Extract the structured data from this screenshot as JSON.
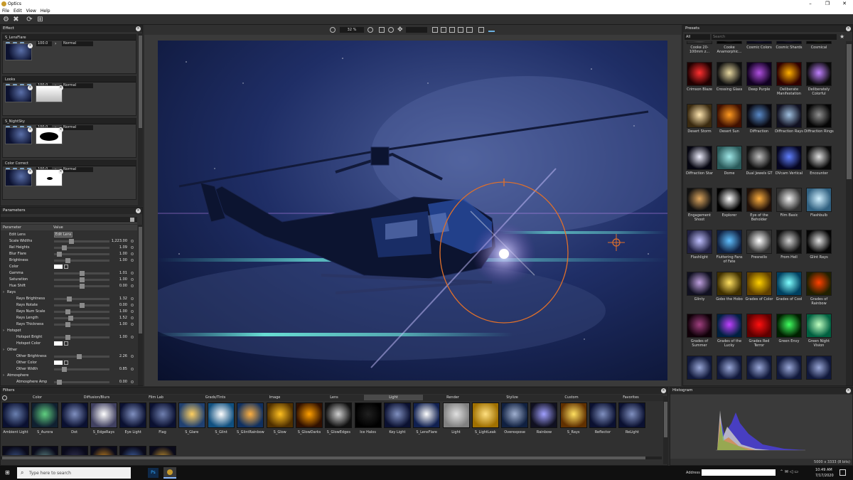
{
  "app": {
    "title": "Optics",
    "window_controls": [
      "–",
      "❐",
      "✕"
    ]
  },
  "menu": [
    "File",
    "Edit",
    "View",
    "Help"
  ],
  "toolbar": {
    "zoom": "32 %"
  },
  "effect": {
    "title": "Effect",
    "layers": [
      {
        "name": "S_LensFlare",
        "opacity": "100.0",
        "mode": "Normal",
        "mask": "none"
      },
      {
        "name": "Looks",
        "opacity": "100.0",
        "mode": "Normal",
        "mask": "gradient"
      },
      {
        "name": "S_NightSky",
        "opacity": "100.0",
        "mode": "Normal",
        "mask": "ellipse"
      },
      {
        "name": "Color Correct",
        "opacity": "100.0",
        "mode": "Normal",
        "mask": "dot"
      }
    ]
  },
  "parameters": {
    "title": "Parameters",
    "col_param": "Parameter",
    "col_value": "Value",
    "rows": [
      {
        "label": "Edit Lens",
        "indent": 1,
        "button": "Edit Lens"
      },
      {
        "label": "Scale Widths",
        "indent": 1,
        "slider": 0.3,
        "value": "1,223.00"
      },
      {
        "label": "Rel Heights",
        "indent": 1,
        "slider": 0.15,
        "value": "1.09"
      },
      {
        "label": "Blur Flare",
        "indent": 1,
        "slider": 0.05,
        "value": "1.00"
      },
      {
        "label": "Brightness",
        "indent": 1,
        "slider": 0.22,
        "value": "1.00"
      },
      {
        "label": "Color",
        "indent": 1,
        "color": "#ffffff"
      },
      {
        "label": "Gamma",
        "indent": 1,
        "slider": 0.5,
        "value": "1.01"
      },
      {
        "label": "Saturation",
        "indent": 1,
        "slider": 0.5,
        "value": "1.00"
      },
      {
        "label": "Hue Shift",
        "indent": 1,
        "slider": 0.5,
        "value": "0.00"
      },
      {
        "label": "Rays",
        "indent": 0,
        "group": true
      },
      {
        "label": "Rays Brightness",
        "indent": 2,
        "slider": 0.25,
        "value": "1.32"
      },
      {
        "label": "Rays Rotate",
        "indent": 2,
        "slider": 0.5,
        "value": "0.00"
      },
      {
        "label": "Rays Num Scale",
        "indent": 2,
        "slider": 0.22,
        "value": "1.00"
      },
      {
        "label": "Rays Length",
        "indent": 2,
        "slider": 0.28,
        "value": "1.52"
      },
      {
        "label": "Rays Thickness",
        "indent": 2,
        "slider": 0.22,
        "value": "1.00"
      },
      {
        "label": "Hotspot",
        "indent": 0,
        "group": true
      },
      {
        "label": "Hotspot Bright",
        "indent": 2,
        "slider": 0.22,
        "value": "1.00"
      },
      {
        "label": "Hotspot Color",
        "indent": 2,
        "color": "#ffffff"
      },
      {
        "label": "Other",
        "indent": 0,
        "group": true
      },
      {
        "label": "Other Brightness",
        "indent": 2,
        "slider": 0.45,
        "value": "2.26"
      },
      {
        "label": "Other Color",
        "indent": 2,
        "color": "#ffffff"
      },
      {
        "label": "Other Width",
        "indent": 2,
        "slider": 0.16,
        "value": "0.85"
      },
      {
        "label": "Atmosphere",
        "indent": 0,
        "group": true
      },
      {
        "label": "Atmosphere Amp",
        "indent": 2,
        "slider": 0.05,
        "value": "0.00"
      }
    ]
  },
  "presets": {
    "title": "Presets",
    "filter": "All",
    "search_placeholder": "Search",
    "items": [
      {
        "label": "Cooke 20-100mm z...",
        "c1": "#e8e8e8",
        "c2": "#2a2a2a"
      },
      {
        "label": "Cooke Anamorphic...",
        "c1": "#9a9a9a",
        "c2": "#050505"
      },
      {
        "label": "Cosmic Colors",
        "c1": "#6a4a9a",
        "c2": "#0a0a1a"
      },
      {
        "label": "Cosmic Shards",
        "c1": "#8a6ab0",
        "c2": "#0a0a15"
      },
      {
        "label": "Cosmical",
        "c1": "#7a9a3a",
        "c2": "#0a0a0a"
      },
      {
        "label": "Crimson Blaze",
        "c1": "#ff3030",
        "c2": "#200000"
      },
      {
        "label": "Crossing Glass",
        "c1": "#e8d8a0",
        "c2": "#101010"
      },
      {
        "label": "Deep Purple",
        "c1": "#b050e0",
        "c2": "#100020"
      },
      {
        "label": "Deliberate Manifestation",
        "c1": "#ffb000",
        "c2": "#300000"
      },
      {
        "label": "Deliberately Colorful",
        "c1": "#c080ff",
        "c2": "#0a0a0a"
      },
      {
        "label": "Desert Storm",
        "c1": "#ffe6b0",
        "c2": "#3a2a10"
      },
      {
        "label": "Desert Sun",
        "c1": "#ff9a20",
        "c2": "#401000"
      },
      {
        "label": "Diffraction",
        "c1": "#5a8ac8",
        "c2": "#080810"
      },
      {
        "label": "Diffraction Rays",
        "c1": "#a0c0e0",
        "c2": "#101020"
      },
      {
        "label": "Diffraction Rings",
        "c1": "#909090",
        "c2": "#050505"
      },
      {
        "label": "Diffraction Star",
        "c1": "#f0f0ff",
        "c2": "#050510"
      },
      {
        "label": "Dome",
        "c1": "#a0e8e8",
        "c2": "#2a5a5a"
      },
      {
        "label": "Dual Jewels GT",
        "c1": "#c0c0c0",
        "c2": "#101010"
      },
      {
        "label": "DVcam Vertical",
        "c1": "#6080ff",
        "c2": "#050520"
      },
      {
        "label": "Encounter",
        "c1": "#e0e0e0",
        "c2": "#080808"
      },
      {
        "label": "Engagement Shoot",
        "c1": "#e0a860",
        "c2": "#101010"
      },
      {
        "label": "Explorer",
        "c1": "#ffffff",
        "c2": "#000000"
      },
      {
        "label": "Eye of the Beholder",
        "c1": "#ffb040",
        "c2": "#201008"
      },
      {
        "label": "Film Basic",
        "c1": "#f0f0f0",
        "c2": "#303030"
      },
      {
        "label": "Flashbulb",
        "c1": "#d0f0ff",
        "c2": "#306080"
      },
      {
        "label": "Flashlight",
        "c1": "#c0c0ff",
        "c2": "#202040"
      },
      {
        "label": "Fluttering Fans of Fate",
        "c1": "#60c0ff",
        "c2": "#102040"
      },
      {
        "label": "Fresnello",
        "c1": "#ffffff",
        "c2": "#303030"
      },
      {
        "label": "From Hell",
        "c1": "#d0d0d0",
        "c2": "#101010"
      },
      {
        "label": "Glint Rays",
        "c1": "#e0e0e0",
        "c2": "#050505"
      },
      {
        "label": "Glinty",
        "c1": "#c0a0e0",
        "c2": "#101020"
      },
      {
        "label": "Gobo the Hobo",
        "c1": "#ffe060",
        "c2": "#403000"
      },
      {
        "label": "Grades of Color",
        "c1": "#ffd000",
        "c2": "#604000"
      },
      {
        "label": "Grades of Cool",
        "c1": "#80ffff",
        "c2": "#004060"
      },
      {
        "label": "Grades of Rainbow",
        "c1": "#ff4000",
        "c2": "#202000"
      },
      {
        "label": "Grades of Summer",
        "c1": "#a04080",
        "c2": "#100008"
      },
      {
        "label": "Grades of the Lucky",
        "c1": "#c040ff",
        "c2": "#002040"
      },
      {
        "label": "Grades Red Terror",
        "c1": "#ff1010",
        "c2": "#600000"
      },
      {
        "label": "Green Envy",
        "c1": "#40ff60",
        "c2": "#002000"
      },
      {
        "label": "Green Night Vision",
        "c1": "#c0ffc0",
        "c2": "#006040"
      }
    ]
  },
  "filters": {
    "title": "Filters",
    "categories": [
      "Color",
      "Diffusion/Blurs",
      "Film Lab",
      "Grads/Tints",
      "Image",
      "Lens",
      "Light",
      "Render",
      "Stylize",
      "Custom",
      "Favorites"
    ],
    "active_category": "Light",
    "items": [
      {
        "label": "Ambient Light",
        "c1": "#6a80b0",
        "c2": "#0a1030"
      },
      {
        "label": "S_Aurora",
        "c1": "#60d080",
        "c2": "#102030"
      },
      {
        "label": "Dot",
        "c1": "#8090c0",
        "c2": "#0a1030"
      },
      {
        "label": "S_EdgeRays",
        "c1": "#ffffff",
        "c2": "#404060"
      },
      {
        "label": "Eye Light",
        "c1": "#8090c0",
        "c2": "#0a1030"
      },
      {
        "label": "Flag",
        "c1": "#7080b0",
        "c2": "#0a1030"
      },
      {
        "label": "S_Glare",
        "c1": "#ffd060",
        "c2": "#204070"
      },
      {
        "label": "S_Glint",
        "c1": "#ffffff",
        "c2": "#105080"
      },
      {
        "label": "S_GlintRainbow",
        "c1": "#ffb040",
        "c2": "#103060"
      },
      {
        "label": "S_Glow",
        "c1": "#ffc020",
        "c2": "#503000"
      },
      {
        "label": "S_GlowDarks",
        "c1": "#ffa000",
        "c2": "#301000"
      },
      {
        "label": "S_GlowEdges",
        "c1": "#d0d0d0",
        "c2": "#101010"
      },
      {
        "label": "Ice Halos",
        "c1": "#202020",
        "c2": "#000000"
      },
      {
        "label": "Key Light",
        "c1": "#8090c0",
        "c2": "#0a1030"
      },
      {
        "label": "S_LensFlare",
        "c1": "#ffffff",
        "c2": "#102050"
      },
      {
        "label": "Light",
        "c1": "#e0e0e0",
        "c2": "#808080"
      },
      {
        "label": "S_LightLeak",
        "c1": "#ffe080",
        "c2": "#a07000"
      },
      {
        "label": "Overexpose",
        "c1": "#a0b0d0",
        "c2": "#102040"
      },
      {
        "label": "Rainbow",
        "c1": "#a0a0ff",
        "c2": "#101020"
      },
      {
        "label": "S_Rays",
        "c1": "#ffe060",
        "c2": "#603000"
      },
      {
        "label": "Reflector",
        "c1": "#8090c0",
        "c2": "#0a1030"
      },
      {
        "label": "ReLight",
        "c1": "#8090c0",
        "c2": "#0a1030"
      }
    ]
  },
  "histogram": {
    "title": "Histogram",
    "image_info": "5000 x 3333 (8 bits)"
  },
  "taskbar": {
    "search_placeholder": "Type here to search",
    "address_label": "Address",
    "time": "10:49 AM",
    "date": "7/17/2020"
  }
}
